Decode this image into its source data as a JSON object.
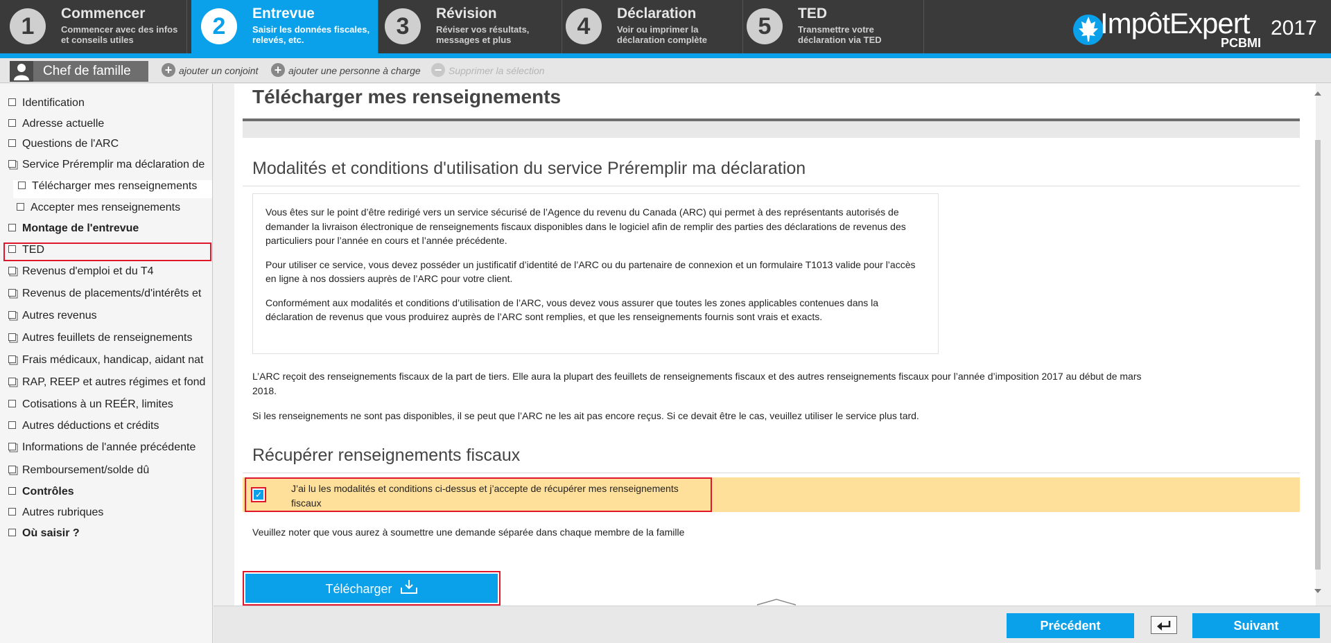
{
  "steps": [
    {
      "num": "1",
      "title": "Commencer",
      "sub": "Commencer avec des infos et conseils utiles",
      "active": false
    },
    {
      "num": "2",
      "title": "Entrevue",
      "sub": "Saisir les données fiscales, relevés, etc.",
      "active": true
    },
    {
      "num": "3",
      "title": "Révision",
      "sub": "Réviser vos résultats, messages et plus",
      "active": false
    },
    {
      "num": "4",
      "title": "Déclaration",
      "sub": "Voir ou imprimer la déclaration complète",
      "active": false
    },
    {
      "num": "5",
      "title": "TED",
      "sub": "Transmettre votre déclaration via TED",
      "active": false
    }
  ],
  "logo": {
    "brand": "ImpôtExpert",
    "sub": "PCBMI",
    "year": "2017"
  },
  "colors": {
    "accent": "#0aa0ea",
    "highlight": "#ffe09b",
    "annotation": "#e0162b",
    "topbar": "#3a3a3a"
  },
  "person": {
    "chef": "Chef de famille",
    "add_spouse": "ajouter un conjoint",
    "add_dependent": "ajouter une personne à charge",
    "delete_selection": "Supprimer la sélection"
  },
  "sidebar": {
    "items": [
      {
        "label": "Identification",
        "bold": false,
        "sub": false,
        "multi": false
      },
      {
        "label": "Adresse actuelle",
        "bold": false,
        "sub": false,
        "multi": false
      },
      {
        "label": "Questions de l'ARC",
        "bold": false,
        "sub": false,
        "multi": false
      },
      {
        "label": "Service Préremplir ma déclaration de",
        "bold": false,
        "sub": false,
        "multi": true
      },
      {
        "label": "Télécharger mes renseignements",
        "bold": false,
        "sub": true,
        "multi": false,
        "current": true
      },
      {
        "label": "Accepter mes renseignements",
        "bold": false,
        "sub": true,
        "multi": false
      },
      {
        "label": "Montage de l'entrevue",
        "bold": true,
        "sub": false,
        "multi": false
      },
      {
        "label": "TED",
        "bold": false,
        "sub": false,
        "multi": false,
        "boxed": true
      },
      {
        "label": "Revenus d'emploi et du T4",
        "bold": false,
        "sub": false,
        "multi": true
      },
      {
        "label": "Revenus de placements/d'intérêts et",
        "bold": false,
        "sub": false,
        "multi": true
      },
      {
        "label": "Autres revenus",
        "bold": false,
        "sub": false,
        "multi": true
      },
      {
        "label": "Autres feuillets de renseignements",
        "bold": false,
        "sub": false,
        "multi": true
      },
      {
        "label": "Frais médicaux, handicap, aidant nat",
        "bold": false,
        "sub": false,
        "multi": true
      },
      {
        "label": "RAP, REEP et autres régimes et fond",
        "bold": false,
        "sub": false,
        "multi": true
      },
      {
        "label": "Cotisations à un REÉR, limites",
        "bold": false,
        "sub": false,
        "multi": false
      },
      {
        "label": "Autres déductions et crédits",
        "bold": false,
        "sub": false,
        "multi": true
      },
      {
        "label": "Informations de l'année précédente",
        "bold": false,
        "sub": false,
        "multi": true
      },
      {
        "label": "Remboursement/solde dû",
        "bold": false,
        "sub": false,
        "multi": true
      },
      {
        "label": "Contrôles",
        "bold": true,
        "sub": false,
        "multi": false
      },
      {
        "label": "Autres rubriques",
        "bold": false,
        "sub": false,
        "multi": false
      },
      {
        "label": "Où saisir ?",
        "bold": true,
        "sub": false,
        "multi": false
      }
    ]
  },
  "main": {
    "page_title": "Télécharger mes renseignements",
    "terms_heading": "Modalités et conditions d'utilisation du service Préremplir ma déclaration",
    "terms_p1": "Vous êtes sur le point d’être redirigé vers un service sécurisé de l’Agence du revenu du Canada (ARC) qui permet à des représentants autorisés de demander la livraison électronique de renseignements fiscaux disponibles dans le logiciel afin de remplir des parties des déclarations de revenus des particuliers pour l’année en cours et l’année précédente.",
    "terms_p2": "Pour utiliser ce service, vous devez posséder un justificatif d’identité de l’ARC ou du partenaire de connexion et un formulaire T1013 valide pour l’accès en ligne à nos dossiers auprès de l’ARC pour votre client.",
    "terms_p3": "Conformément aux modalités et conditions d’utilisation de l’ARC, vous devez vous assurer que toutes les zones applicables contenues dans la déclaration de revenus que vous produirez auprès de l’ARC sont remplies, et que les renseignements fournis sont vrais et exacts.",
    "info_p1": "L’ARC reçoit des renseignements fiscaux de la part de tiers. Elle aura la plupart des feuillets de renseignements fiscaux et des autres renseignements fiscaux pour l’année d’imposition 2017 au début de mars 2018.",
    "info_p2": "Si les renseignements ne sont pas disponibles, il se peut que l’ARC ne les ait pas encore reçus. Si ce devait être le cas, veuillez utiliser le service plus tard.",
    "retrieve_heading": "Récupérer renseignements fiscaux",
    "accept_label": "J’ai lu les modalités et conditions ci-dessus et j’accepte de récupérer mes renseignements fiscaux",
    "accept_checked": true,
    "note": "Veuillez noter que vous aurez à soumettre une demande séparée dans chaque membre de la famille",
    "download_label": "Télécharger"
  },
  "nav": {
    "prev": "Précédent",
    "next": "Suivant"
  }
}
